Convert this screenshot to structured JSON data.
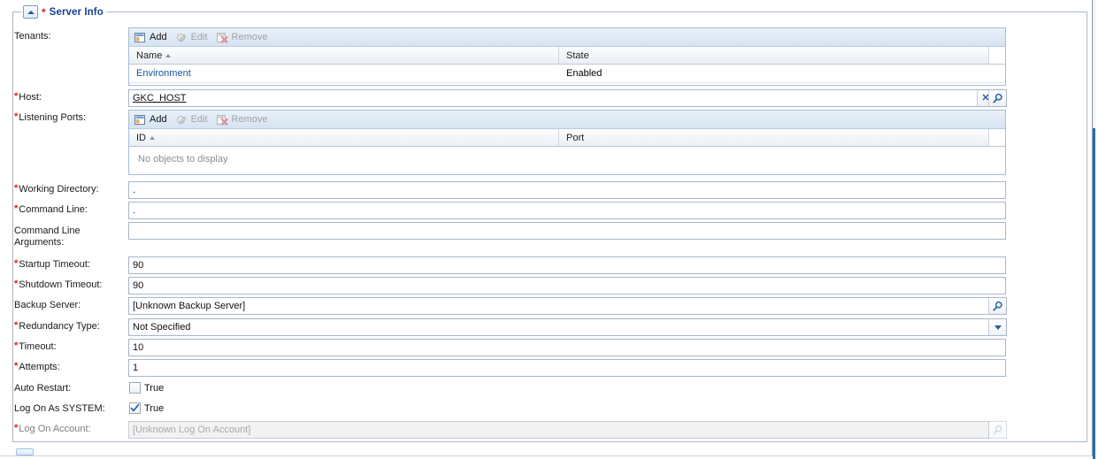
{
  "group": {
    "legend": "Server Info",
    "required_marker": "*",
    "collapse_icon": "triangle-up-icon"
  },
  "toolbar": {
    "add_label": "Add",
    "edit_label": "Edit",
    "remove_label": "Remove",
    "add_icon": "add-row-icon",
    "edit_icon": "edit-pencil-icon",
    "remove_icon": "remove-row-icon"
  },
  "fields": {
    "tenants": {
      "label": "Tenants:",
      "required": false
    },
    "host": {
      "label": "Host:",
      "required": true,
      "value": "GKC_HOST",
      "clear_icon": "clear-x-icon",
      "lookup_icon": "search-icon"
    },
    "listening_ports": {
      "label": "Listening Ports:",
      "required": true
    },
    "working_directory": {
      "label": "Working Directory:",
      "required": true,
      "value": "."
    },
    "command_line": {
      "label": "Command Line:",
      "required": true,
      "value": "."
    },
    "command_line_arguments": {
      "label_line1": "Command Line",
      "label_line2": "Arguments:",
      "required": false,
      "value": ""
    },
    "startup_timeout": {
      "label": "Startup Timeout:",
      "required": true,
      "value": "90"
    },
    "shutdown_timeout": {
      "label": "Shutdown Timeout:",
      "required": true,
      "value": "90"
    },
    "backup_server": {
      "label": "Backup Server:",
      "required": false,
      "value": "[Unknown Backup Server]",
      "lookup_icon": "search-icon"
    },
    "redundancy_type": {
      "label": "Redundancy Type:",
      "required": true,
      "value": "Not Specified",
      "dropdown_icon": "chevron-down-icon"
    },
    "timeout": {
      "label": "Timeout:",
      "required": true,
      "value": "10"
    },
    "attempts": {
      "label": "Attempts:",
      "required": true,
      "value": "1"
    },
    "auto_restart": {
      "label": "Auto Restart:",
      "required": false,
      "checkbox_label": "True",
      "checked": false
    },
    "log_on_as_system": {
      "label": "Log On As SYSTEM:",
      "required": false,
      "checkbox_label": "True",
      "checked": true
    },
    "log_on_account": {
      "label": "Log On Account:",
      "required": true,
      "placeholder": "[Unknown Log On Account]",
      "value": "",
      "disabled": true,
      "lookup_icon": "search-icon"
    }
  },
  "tenants_grid": {
    "columns": [
      "Name",
      "State"
    ],
    "sort_column": "Name",
    "sort_direction": "asc",
    "rows": [
      {
        "name": "Environment",
        "state": "Enabled"
      }
    ]
  },
  "listening_ports_grid": {
    "columns": [
      "ID",
      "Port"
    ],
    "sort_column": "ID",
    "sort_direction": "asc",
    "rows": [],
    "empty_text": "No objects to display"
  },
  "colors": {
    "legend": "#16408f",
    "required": "#e01b1b",
    "link": "#15539e",
    "scrollbar": "#2f6ca8",
    "grid_header_border": "#bcc8d6"
  }
}
